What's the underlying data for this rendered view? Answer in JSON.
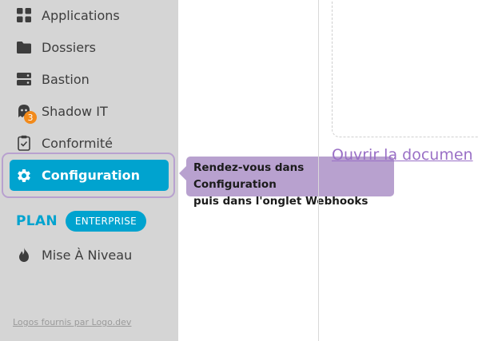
{
  "sidebar": {
    "items": [
      {
        "label": "Applications",
        "icon": "grid-icon"
      },
      {
        "label": "Dossiers",
        "icon": "folder-icon"
      },
      {
        "label": "Bastion",
        "icon": "server-icon"
      },
      {
        "label": "Shadow IT",
        "icon": "ghost-icon",
        "badge": "3"
      },
      {
        "label": "Conformité",
        "icon": "clipboard-check-icon"
      },
      {
        "label": "Configuration",
        "icon": "gear-icon",
        "active": true
      },
      {
        "label": "Mise À Niveau",
        "icon": "flame-icon"
      }
    ],
    "plan_label": "PLAN",
    "plan_badge": "ENTERPRISE",
    "footer_link": "Logos fournis par Logo.dev"
  },
  "tooltip": {
    "line1": "Rendez-vous dans Configuration",
    "line2": "puis dans l'onglet Webhooks"
  },
  "main": {
    "doc_link": "Ouvrir la documen"
  },
  "colors": {
    "accent": "#00a3cf",
    "sidebar_bg": "#d5d5d5",
    "tooltip_bg": "#b8a1cf",
    "badge": "#f28a1b",
    "link": "#9a70c6"
  }
}
